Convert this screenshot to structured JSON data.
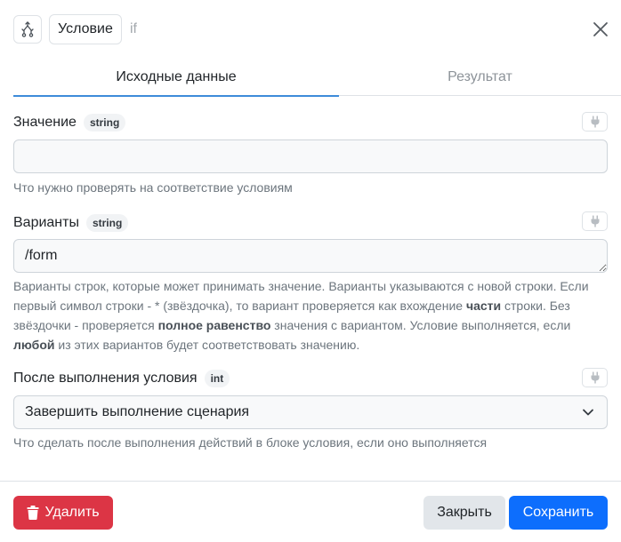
{
  "header": {
    "node_icon": "merge-branch-icon",
    "title": "Условие",
    "tag": "if",
    "close_icon": "close-icon"
  },
  "tabs": [
    {
      "label": "Исходные данные",
      "active": true
    },
    {
      "label": "Результат",
      "active": false
    }
  ],
  "fields": {
    "value": {
      "label": "Значение",
      "type": "string",
      "value": "",
      "help": "Что нужно проверять на соответствие условиям"
    },
    "variants": {
      "label": "Варианты",
      "type": "string",
      "value": "/form",
      "help": {
        "p1": "Варианты строк, которые может принимать значение. Варианты указываются с новой строки. Если первый символ строки - * (звёздочка), то вариант проверяется как вхождение ",
        "b1": "части",
        "p2": " строки. Без звёздочки - проверяется ",
        "b2": "полное равенство",
        "p3": " значения с вариантом. Условие выполняется, если ",
        "b3": "любой",
        "p4": " из этих вариантов будет соответствовать значению."
      }
    },
    "after": {
      "label": "После выполнения условия",
      "type": "int",
      "selected": "Завершить выполнение сценария",
      "help": "Что сделать после выполнения действий в блоке условия, если оно выполняется"
    }
  },
  "footer": {
    "delete_label": "Удалить",
    "close_label": "Закрыть",
    "save_label": "Сохранить"
  },
  "colors": {
    "primary": "#0d6efd",
    "danger": "#dc3545",
    "tab_underline": "#3d8bd9"
  }
}
